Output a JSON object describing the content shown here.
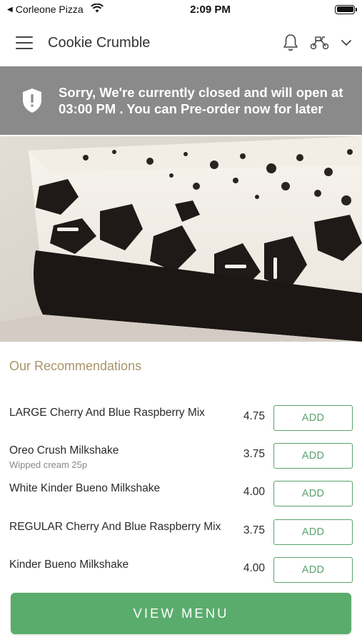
{
  "status_bar": {
    "back_app": "Corleone Pizza",
    "time": "2:09 PM"
  },
  "header": {
    "title": "Cookie Crumble",
    "icons": [
      "hamburger-menu-icon",
      "bell-icon",
      "scooter-icon",
      "chevron-down-icon"
    ]
  },
  "banner": {
    "icon": "shield-alert-icon",
    "message": "Sorry, We're currently closed and will open at 03:00 PM . You can Pre-order now for later"
  },
  "recommendations": {
    "title": "Our Recommendations",
    "items": [
      {
        "name": "LARGE Cherry And Blue Raspberry Mix",
        "subtitle": "",
        "price": "4.75",
        "button": "ADD"
      },
      {
        "name": "Oreo Crush Milkshake",
        "subtitle": "Wipped cream 25p",
        "price": "3.75",
        "button": "ADD"
      },
      {
        "name": "White Kinder Bueno Milkshake",
        "subtitle": "",
        "price": "4.00",
        "button": "ADD"
      },
      {
        "name": "REGULAR Cherry And Blue Raspberry Mix",
        "subtitle": "",
        "price": "3.75",
        "button": "ADD"
      },
      {
        "name": "Kinder Bueno Milkshake",
        "subtitle": "",
        "price": "4.00",
        "button": "ADD"
      }
    ]
  },
  "view_menu_label": "VIEW MENU",
  "colors": {
    "accent_green": "#5aac6d",
    "banner_gray": "#8a8a8a",
    "section_title": "#a89468"
  }
}
